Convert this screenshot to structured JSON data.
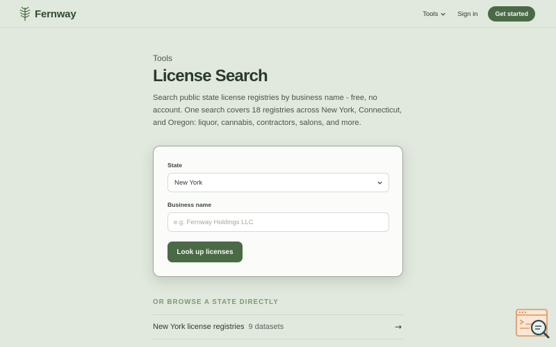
{
  "header": {
    "brand_name": "Fernway",
    "nav": {
      "tools_label": "Tools",
      "signin_label": "Sign in",
      "cta_label": "Get started"
    }
  },
  "main": {
    "eyebrow": "Tools",
    "title": "License Search",
    "intro": "Search public state license registries by business name - free, no account. One search covers 18 registries across New York, Connecticut, and Oregon: liquor, cannabis, contractors, salons, and more."
  },
  "form": {
    "state_label": "State",
    "state_selected": "New York",
    "business_label": "Business name",
    "business_value": "",
    "business_placeholder": "e.g. Fernway Holdings LLC",
    "submit_label": "Look up licenses"
  },
  "browse": {
    "heading": "OR BROWSE A STATE DIRECTLY",
    "rows": [
      {
        "name": "New York license registries",
        "count": "9 datasets",
        "arrow": "→"
      }
    ]
  },
  "colors": {
    "background": "#e1e8dd",
    "accent": "#4a6a45",
    "eyebrow_accent": "#7a9a72"
  },
  "icons": {
    "brand": "fern-leaf-icon",
    "tools_caret": "chevron-down-icon",
    "select_caret": "chevron-down-icon",
    "row_arrow": "arrow-right-icon",
    "floating": "search-document-icon"
  }
}
